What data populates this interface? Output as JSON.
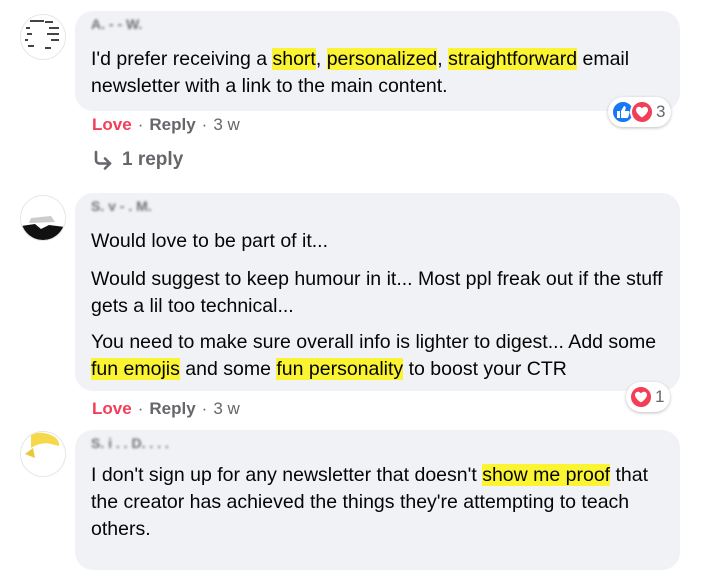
{
  "comments": [
    {
      "author": "A.  -  - W.",
      "paragraphs": [
        [
          {
            "t": "I'd prefer receiving a "
          },
          {
            "t": "short",
            "h": true
          },
          {
            "t": ", "
          },
          {
            "t": "personalized",
            "h": true
          },
          {
            "t": ", "
          },
          {
            "t": "straightforward",
            "h": true
          },
          {
            "t": " email newsletter with a link to the main content."
          }
        ]
      ],
      "action_love": "Love",
      "action_reply": "Reply",
      "time": "3 w",
      "reaction_count": "3",
      "reaction_icons": [
        "like-icon",
        "love-icon"
      ],
      "replies_label": "1 reply"
    },
    {
      "author": "S. y  -  .  M.",
      "paragraphs": [
        [
          {
            "t": "Would love to be part of it..."
          }
        ],
        [
          {
            "t": "Would suggest to keep humour in it... Most ppl freak out if the stuff gets a lil too technical..."
          }
        ],
        [
          {
            "t": "You need to make sure overall info is lighter to digest... Add some "
          },
          {
            "t": "fun emojis",
            "h": true
          },
          {
            "t": " and some "
          },
          {
            "t": "fun personality",
            "h": true
          },
          {
            "t": " to boost your CTR"
          }
        ]
      ],
      "action_love": "Love",
      "action_reply": "Reply",
      "time": "3 w",
      "reaction_count": "1",
      "reaction_icons": [
        "love-icon"
      ]
    },
    {
      "author": "S. j . .  D.  . . .",
      "paragraphs": [
        [
          {
            "t": "I don't sign up for any newsletter that doesn't "
          },
          {
            "t": "show me proof",
            "h": true
          },
          {
            "t": " that the creator has achieved the things they're attempting to teach others."
          }
        ]
      ]
    }
  ],
  "colors": {
    "highlight": "#fbf432",
    "bubble": "#f0f2f5",
    "love": "#f33e58",
    "like": "#1877f2",
    "muted": "#65676b"
  },
  "separator": "·"
}
